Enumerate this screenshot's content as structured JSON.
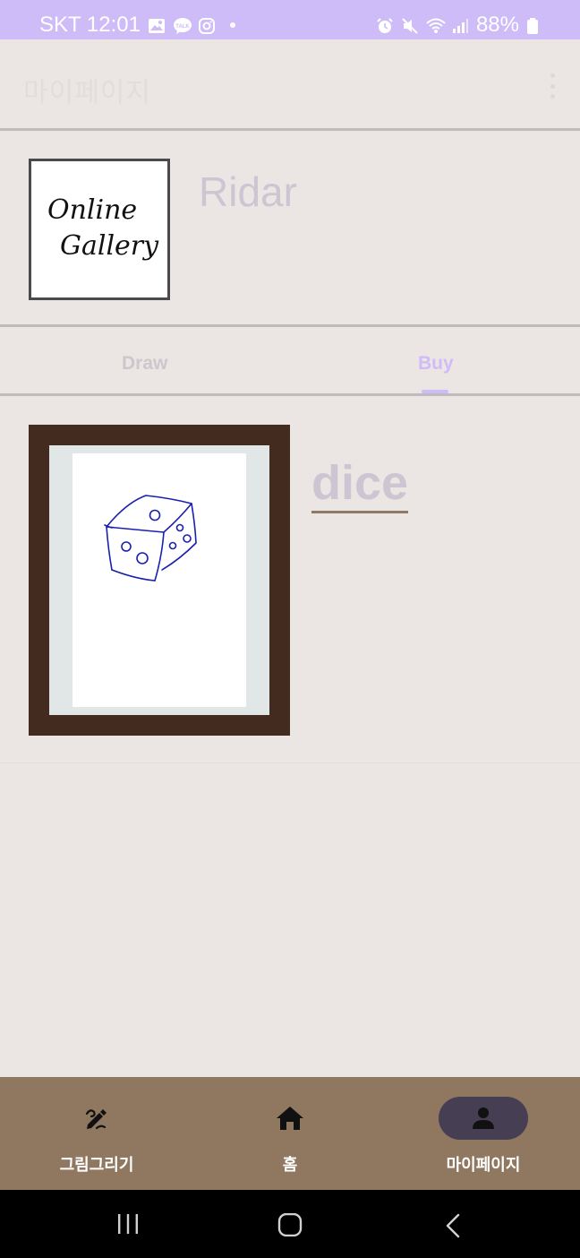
{
  "status_bar": {
    "carrier_time": "SKT 12:01",
    "battery": "88%",
    "left_icons": [
      "gallery-icon",
      "talk-icon",
      "instagram-icon"
    ],
    "right_icons": [
      "alarm-icon",
      "mute-icon",
      "wifi-icon",
      "signal-icon",
      "battery-icon"
    ]
  },
  "app_bar": {
    "title": "마이페이지",
    "menu_icon": "more-vert-icon"
  },
  "profile": {
    "logo_line1": "Online",
    "logo_line2": "Gallery",
    "username": "Ridar"
  },
  "tabs": [
    {
      "label": "Draw",
      "selected": false
    },
    {
      "label": "Buy",
      "selected": true
    }
  ],
  "items": [
    {
      "title": "dice",
      "image": "dice drawing"
    }
  ],
  "bottom_nav": [
    {
      "label": "그림그리기",
      "icon": "draw-icon",
      "selected": false
    },
    {
      "label": "홈",
      "icon": "home-icon",
      "selected": false
    },
    {
      "label": "마이페이지",
      "icon": "person-icon",
      "selected": true
    }
  ],
  "system_nav": [
    "recents-icon",
    "home-button-icon",
    "back-icon"
  ],
  "colors": {
    "status_bar": "#cdbcf7",
    "background": "#ebe6e3",
    "accent": "#cdbcf7",
    "nav_background": "#8f7760",
    "nav_active_pill": "#463e52",
    "frame": "#432c1f"
  }
}
